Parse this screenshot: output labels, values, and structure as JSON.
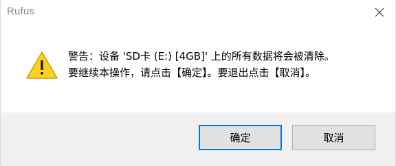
{
  "window": {
    "title": "Rufus"
  },
  "message": {
    "line1": "警告：设备 'SD卡 (E:) [4GB]' 上的所有数据将会被清除。",
    "line2": "要继续本操作，请点击【确定】。要退出点击【取消】。"
  },
  "icons": {
    "warning": "warning-icon",
    "close": "close-icon"
  },
  "buttons": {
    "ok_label": "确定",
    "cancel_label": "取消"
  },
  "colors": {
    "warning_fill": "#FFD21E",
    "warning_border": "#C8A000",
    "focus_border": "#0078D7",
    "footer_bg": "#F0F0F0"
  }
}
